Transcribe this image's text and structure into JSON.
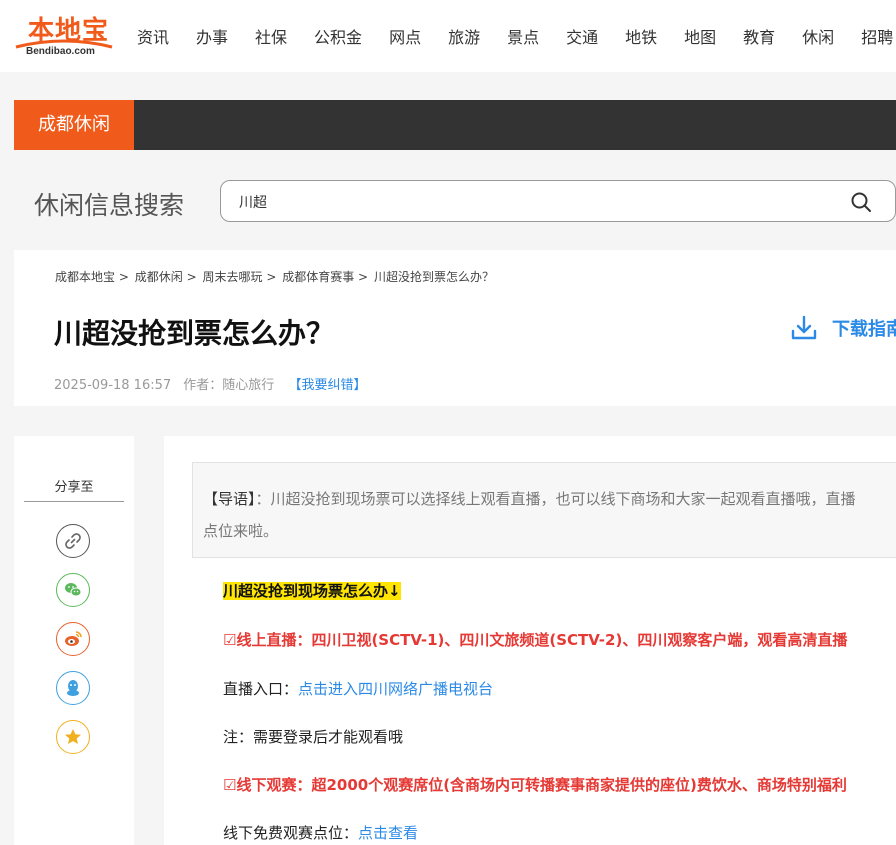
{
  "header": {
    "logo_text": "本地宝",
    "logo_sub": "Bendibao.com",
    "nav_items": [
      "资讯",
      "办事",
      "社保",
      "公积金",
      "网点",
      "旅游",
      "景点",
      "交通",
      "地铁",
      "地图",
      "教育",
      "休闲",
      "招聘"
    ]
  },
  "channel": {
    "tab_label": "成都休闲"
  },
  "search": {
    "title": "休闲信息搜索",
    "value": "川超"
  },
  "breadcrumb": [
    "成都本地宝",
    ">",
    "成都休闲",
    ">",
    "周末去哪玩",
    ">",
    "成都体育赛事",
    ">",
    "川超没抢到票怎么办？"
  ],
  "article": {
    "title": "川超没抢到票怎么办？",
    "download_label": "下载指南",
    "date": "2025-09-18 16:57",
    "author": "作者：随心旅行",
    "report": "【我要纠错】"
  },
  "share": {
    "title": "分享至",
    "buttons": [
      "link-icon",
      "wechat-icon",
      "weibo-icon",
      "qq-icon",
      "qzone-icon"
    ]
  },
  "content": {
    "lead_label": "【导语】",
    "lead_text_1": "：川超没抢到现场票可以选择线上观看直播，也可以线下商场和大家一起观看直播哦，直播",
    "lead_text_2": "点位来啦。",
    "heading": "川超没抢到现场票怎么办↓",
    "online_title": "☑线上直播：四川卫视(SCTV-1)、四川文旅频道(SCTV-2)、四川观察客户端，观看高清直播",
    "live_entry_label": "直播入口：",
    "live_entry_link": "点击进入四川网络广播电视台",
    "note": "注：需要登录后才能观看哦",
    "offline_title": "☑线下观赛：超2000个观赛席位(含商场内可转播赛事商家提供的座位)费饮水、商场特别福利",
    "offline_points_label": "线下免费观赛点位：",
    "offline_points_link": "点击查看"
  },
  "colors": {
    "brand": "#f05a1a",
    "link": "#2b8ae6",
    "highlight": "#ffe500",
    "alert": "#e53935"
  }
}
